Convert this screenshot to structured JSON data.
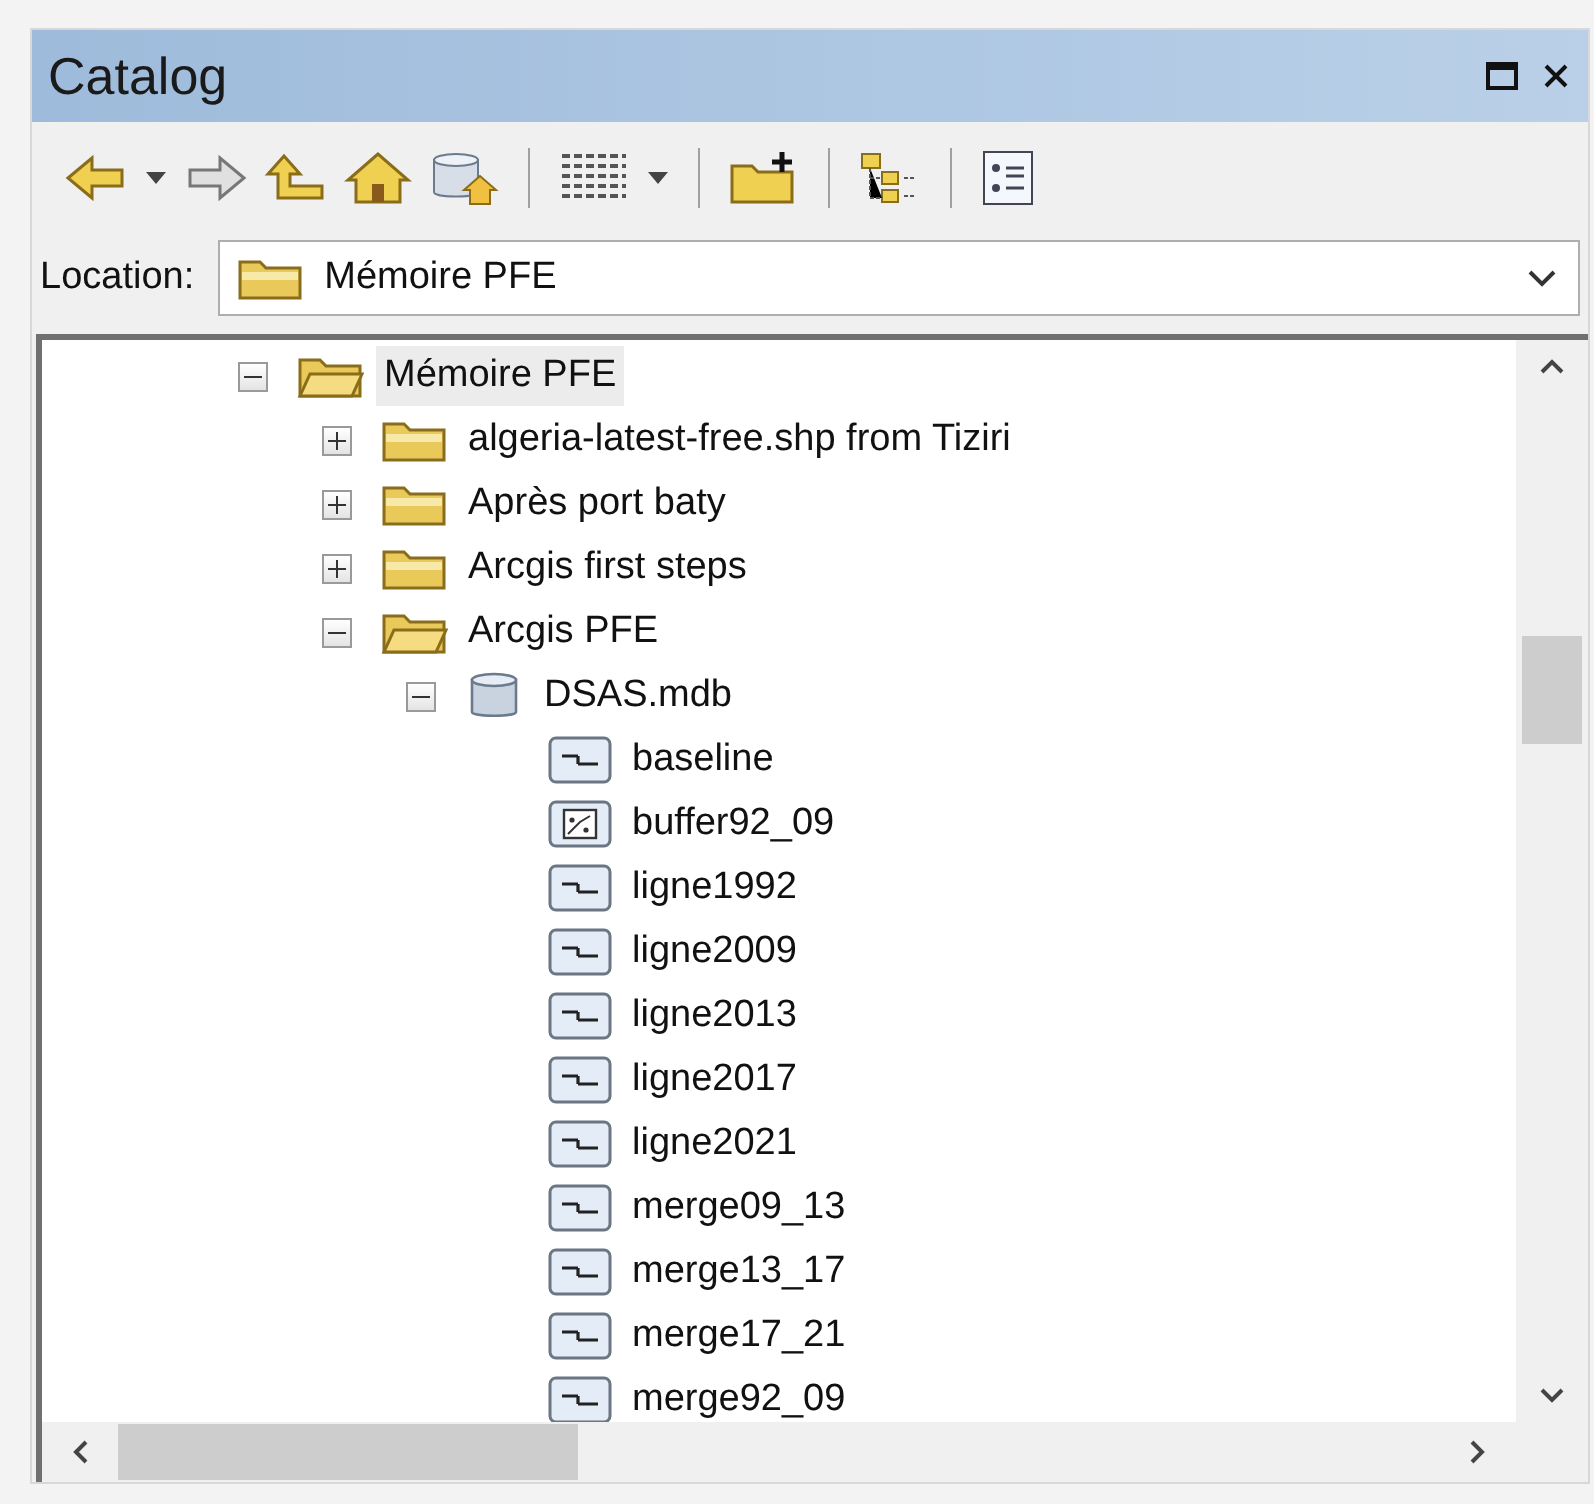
{
  "window": {
    "title": "Catalog"
  },
  "location": {
    "label": "Location:",
    "value": "Mémoire PFE"
  },
  "tree": [
    {
      "label": "Mémoire PFE",
      "kind": "folder",
      "expanded": true,
      "selected": true,
      "children": [
        {
          "label": "algeria-latest-free.shp from Tiziri",
          "kind": "folder",
          "expanded": false,
          "selected": false
        },
        {
          "label": "Après port baty",
          "kind": "folder",
          "expanded": false,
          "selected": false
        },
        {
          "label": "Arcgis first steps",
          "kind": "folder",
          "expanded": false,
          "selected": false
        },
        {
          "label": "Arcgis PFE",
          "kind": "folder",
          "expanded": true,
          "selected": false,
          "children": [
            {
              "label": "DSAS.mdb",
              "kind": "database",
              "expanded": true,
              "selected": false,
              "children": [
                {
                  "label": "baseline",
                  "kind": "line",
                  "selected": false
                },
                {
                  "label": "buffer92_09",
                  "kind": "polygon",
                  "selected": false
                },
                {
                  "label": "ligne1992",
                  "kind": "line",
                  "selected": false
                },
                {
                  "label": "ligne2009",
                  "kind": "line",
                  "selected": false
                },
                {
                  "label": "ligne2013",
                  "kind": "line",
                  "selected": false
                },
                {
                  "label": "ligne2017",
                  "kind": "line",
                  "selected": false
                },
                {
                  "label": "ligne2021",
                  "kind": "line",
                  "selected": false
                },
                {
                  "label": "merge09_13",
                  "kind": "line",
                  "selected": false
                },
                {
                  "label": "merge13_17",
                  "kind": "line",
                  "selected": false
                },
                {
                  "label": "merge17_21",
                  "kind": "line",
                  "selected": false
                },
                {
                  "label": "merge92_09",
                  "kind": "line",
                  "selected": false
                }
              ]
            }
          ]
        }
      ]
    }
  ]
}
